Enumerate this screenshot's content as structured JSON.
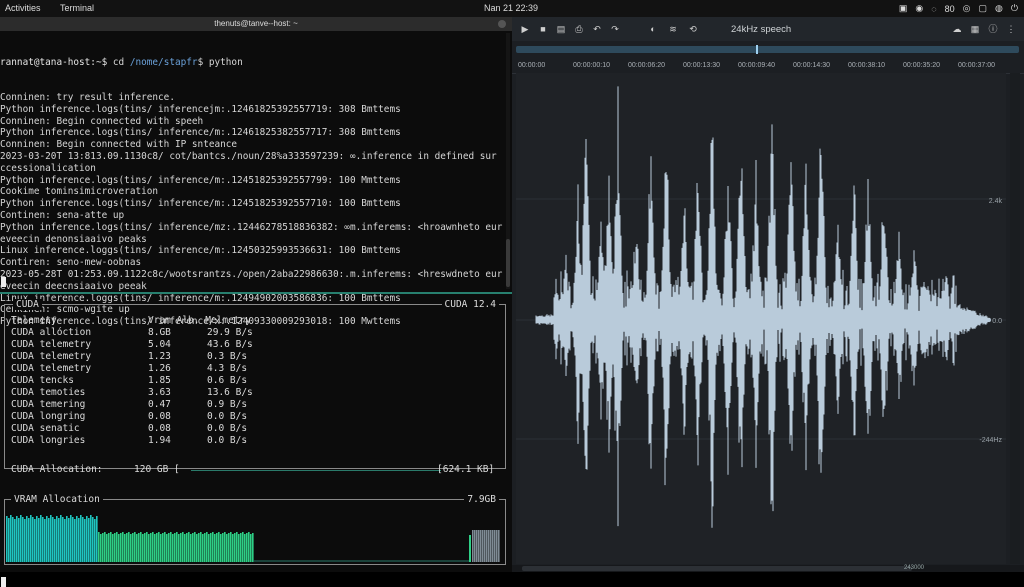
{
  "topbar": {
    "activities": "Activities",
    "app": "Terminal",
    "clock": "Nan 21  22:39",
    "tray": [
      "▣",
      "◉",
      "◌",
      "80",
      "◎",
      "▢",
      "◍",
      "⏻"
    ]
  },
  "terminal": {
    "title": "thenuts@tanve--host: ~",
    "prompt_host": "rannat@tana-host:~$",
    "prompt_cmd_pre": " cd ",
    "prompt_path": "/nome/stapfr",
    "prompt_cmd_post": "$ python",
    "lines": [
      "Conninen: try result inference.",
      "Python inference.logs(tins/ inferencejm:.12461825392557719: 308 Bmttems",
      "Conninen: Begin connected with speeh",
      "Python inference.logs(tins/ inference/m:.12461825382557717: 308 Bmttems",
      "Conninen: Begin connected with IP snteance",
      "2023-03-20T 13:813.09.1130c8/ cot/bantcs./noun/28%a333597239: ∞.inference in defined sur",
      "ccessionalication",
      "Python inference.logs(tins/ inference/m:.12451825392557799: 100 Mmttems",
      "Cookime tominsimicroveration",
      "Python inference.logs(tins/ inference/m:.12451825392557710: 100 Bmttems",
      "Continen: sena-atte up",
      "Python inference.logs(tins/ inference/mz:.12446278518836382: ∞m.inferems: <hroawnheto eur",
      "eveecin denonsiaaivo peaks",
      "Linux inference.loggs(tins/ inference/m:.12450325993536631: 100 Bmttems",
      "Contiren: seno-mew-oobnas",
      "2023-05-28T 01:253.09.1122c8c/wootsrantzs./open/2aba22986630:.m.inferems: <hreswdneto eur",
      "eveecin deecnsiaaivo peeak",
      "Linux inference.loggs(tins/ inference/m:.12494902003586836: 100 Bmttems",
      "Cenkinen: scmo-wgite up",
      "Python inference.logs(tins/ inference/x:.12409330009293018: 100 Mwttems"
    ],
    "cuda": {
      "title": "CUDA",
      "version": "CUDA 12.4",
      "headers": [
        "Telemety",
        "Vram Alb. Melmetry"
      ],
      "rows": [
        {
          "name": "CUDA allóction",
          "vram": "8.GB",
          "rate": "29.9 B/s"
        },
        {
          "name": "CUDA telemetry",
          "vram": "5.04",
          "rate": "43.6 B/s"
        },
        {
          "name": "CUDA telemetry",
          "vram": "1.23",
          "rate": "0.3 B/s"
        },
        {
          "name": "CUDA telemetry",
          "vram": "1.26",
          "rate": "4.3 B/s"
        },
        {
          "name": "CUDA tencks",
          "vram": "1.85",
          "rate": "0.6 B/s"
        },
        {
          "name": "CUDA temoties",
          "vram": "3.63",
          "rate": "13.6 B/s"
        },
        {
          "name": "CUDA temering",
          "vram": "0.47",
          "rate": "0.9 B/s"
        },
        {
          "name": "CUDA longring",
          "vram": "0.08",
          "rate": "0.0 B/s"
        },
        {
          "name": "CUDA senatic",
          "vram": "0.08",
          "rate": "0.0 B/s"
        },
        {
          "name": "CUDA longries",
          "vram": "1.94",
          "rate": "0.0 B/s"
        }
      ],
      "allocation_label": "CUDA Allocation:",
      "allocation_value": "120 GB [",
      "allocation_total": "[624.1 KB]"
    },
    "vram": {
      "title": "VRAM Allocation",
      "value": "7.9GB",
      "colors": {
        "high": "#1fc6c0",
        "mid": "#2ecf86",
        "tail": "#7f8c95"
      }
    }
  },
  "audio": {
    "file": "24kHz speech",
    "toolbar_icons": [
      "play-icon",
      "stop-icon",
      "save-icon",
      "print-icon",
      "undo-icon",
      "redo-icon",
      "trim-icon",
      "waveform-icon",
      "loop-icon"
    ],
    "timeline": [
      "00:00:00",
      "00:00:00:10",
      "00:00:06:20",
      "00:00:13:30",
      "00:00:09:40",
      "00:00:14:30",
      "00:00:38:10",
      "00:00:35:20",
      "00:00:37:00"
    ],
    "scale_labels": [
      "2.4k",
      "0.0",
      "-244Hz"
    ],
    "zoom": "243000",
    "wave_color": "#b9cbda"
  }
}
